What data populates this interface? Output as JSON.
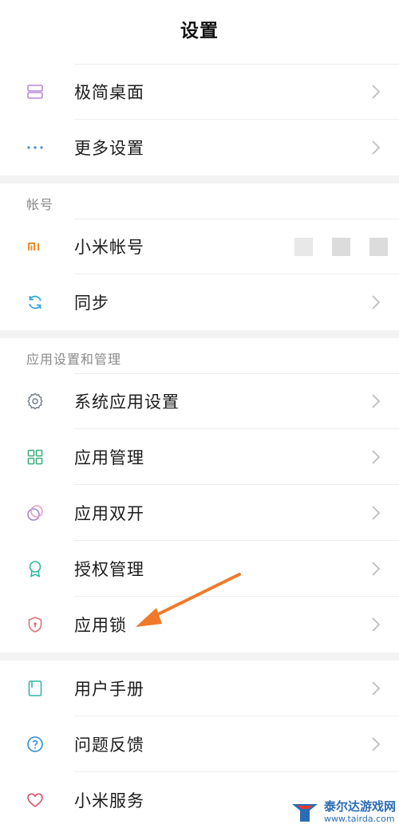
{
  "header": {
    "title": "设置"
  },
  "group1": {
    "items": [
      {
        "label": "极简桌面",
        "icon": "minimal-desktop-icon"
      },
      {
        "label": "更多设置",
        "icon": "more-dots-icon"
      }
    ]
  },
  "account": {
    "section_title": "帐号",
    "items": [
      {
        "label": "小米帐号",
        "icon": "mi-logo-icon"
      },
      {
        "label": "同步",
        "icon": "sync-icon"
      }
    ]
  },
  "apps": {
    "section_title": "应用设置和管理",
    "items": [
      {
        "label": "系统应用设置",
        "icon": "gear-icon"
      },
      {
        "label": "应用管理",
        "icon": "grid-icon"
      },
      {
        "label": "应用双开",
        "icon": "dual-app-icon"
      },
      {
        "label": "授权管理",
        "icon": "badge-icon"
      },
      {
        "label": "应用锁",
        "icon": "shield-lock-icon"
      }
    ]
  },
  "support": {
    "items": [
      {
        "label": "用户手册",
        "icon": "book-icon"
      },
      {
        "label": "问题反馈",
        "icon": "question-icon"
      },
      {
        "label": "小米服务",
        "icon": "heart-icon"
      }
    ]
  },
  "watermark": {
    "name": "泰尔达游戏网",
    "url": "www.tairda.com"
  },
  "colors": {
    "accent_orange": "#f07a2a",
    "mi_orange": "#f08a24",
    "divider": "#ececec",
    "gap": "#f3f3f3"
  }
}
